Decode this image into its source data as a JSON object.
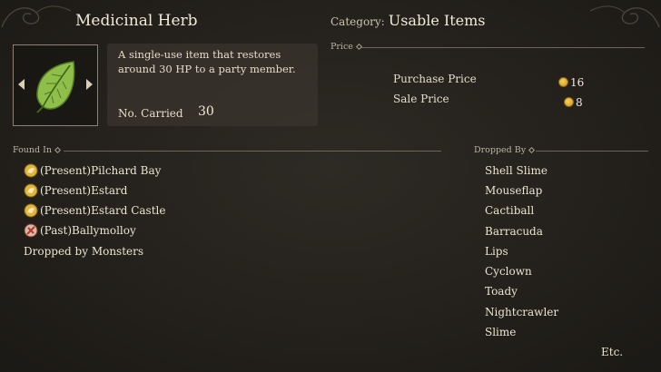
{
  "item": {
    "name": "Medicinal Herb",
    "category_label": "Category:",
    "category_value": "Usable Items",
    "description": "A single-use item that restores around 30 HP to a party member.",
    "carried_label": "No. Carried",
    "carried_value": "30",
    "icon": "leaf-icon"
  },
  "price": {
    "section_label": "Price",
    "purchase_label": "Purchase Price",
    "purchase_value": "16",
    "sale_label": "Sale Price",
    "sale_value": "8",
    "currency_icon": "gold-coin-icon"
  },
  "found_in": {
    "section_label": "Found In",
    "locations": [
      {
        "label": "(Present)Pilchard Bay",
        "icon": "present-world-icon"
      },
      {
        "label": "(Present)Estard",
        "icon": "present-world-icon"
      },
      {
        "label": "(Present)Estard Castle",
        "icon": "present-world-icon"
      },
      {
        "label": "(Past)Ballymolloy",
        "icon": "past-world-icon"
      }
    ],
    "dropped_by_monsters": "Dropped by Monsters"
  },
  "dropped_by": {
    "section_label": "Dropped By",
    "monsters": [
      "Shell Slime",
      "Mouseflap",
      "Cactiball",
      "Barracuda",
      "Lips",
      "Cyclown",
      "Toady",
      "Nightcrawler",
      "Slime"
    ],
    "more": "Etc."
  },
  "colors": {
    "background": "#25221d",
    "text": "#ece6d6",
    "coin": "#e8c040"
  }
}
